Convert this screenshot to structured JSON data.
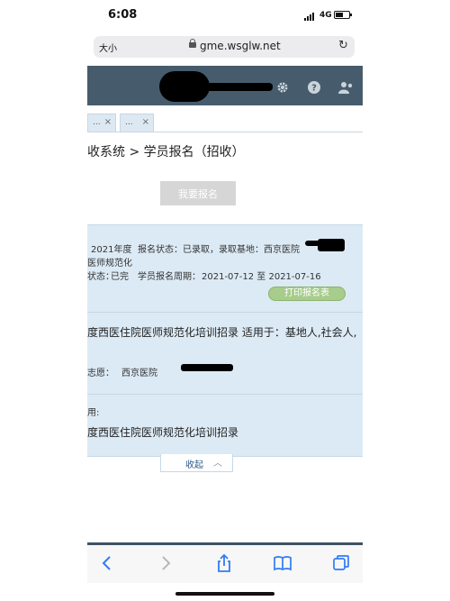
{
  "status": {
    "time": "6:08",
    "network": "4G"
  },
  "browser": {
    "text_size": "大小",
    "url": "gme.wsglw.net"
  },
  "tabs": [
    {
      "label": "...",
      "close": "×"
    },
    {
      "label": "...",
      "close": "×"
    }
  ],
  "page": {
    "breadcrumb": "收系统 > 学员报名（招收）",
    "apply_button": "我要报名"
  },
  "record": {
    "year": "2021年度",
    "apply_status_label": "报名状态：",
    "apply_status": "已录取，录取基地：西京医院",
    "category": "医师规范化",
    "state_label": "状态：",
    "state": "已完",
    "period_label": "学员报名周期：",
    "period": "2021-07-12 至 2021-07-16",
    "print_button": "打印报名表",
    "title_line": "度西医住院医师规范化培训招录 适用于：基地人,社会人,",
    "wish_label": "志愿：",
    "wish": "西京医院",
    "use_label": "用:",
    "use_value": "度西医住院医师规范化培训招录",
    "collapse": "收起"
  },
  "icons": {
    "header": [
      "gear-icon",
      "help-icon",
      "user-icon"
    ],
    "toolbar": [
      "back-icon",
      "forward-icon",
      "share-icon",
      "bookmarks-icon",
      "tabs-icon"
    ]
  },
  "colors": {
    "header": "#465c6d",
    "panel": "#dceaf5",
    "print_button": "#a7cc8c",
    "link": "#2c5a8a"
  }
}
